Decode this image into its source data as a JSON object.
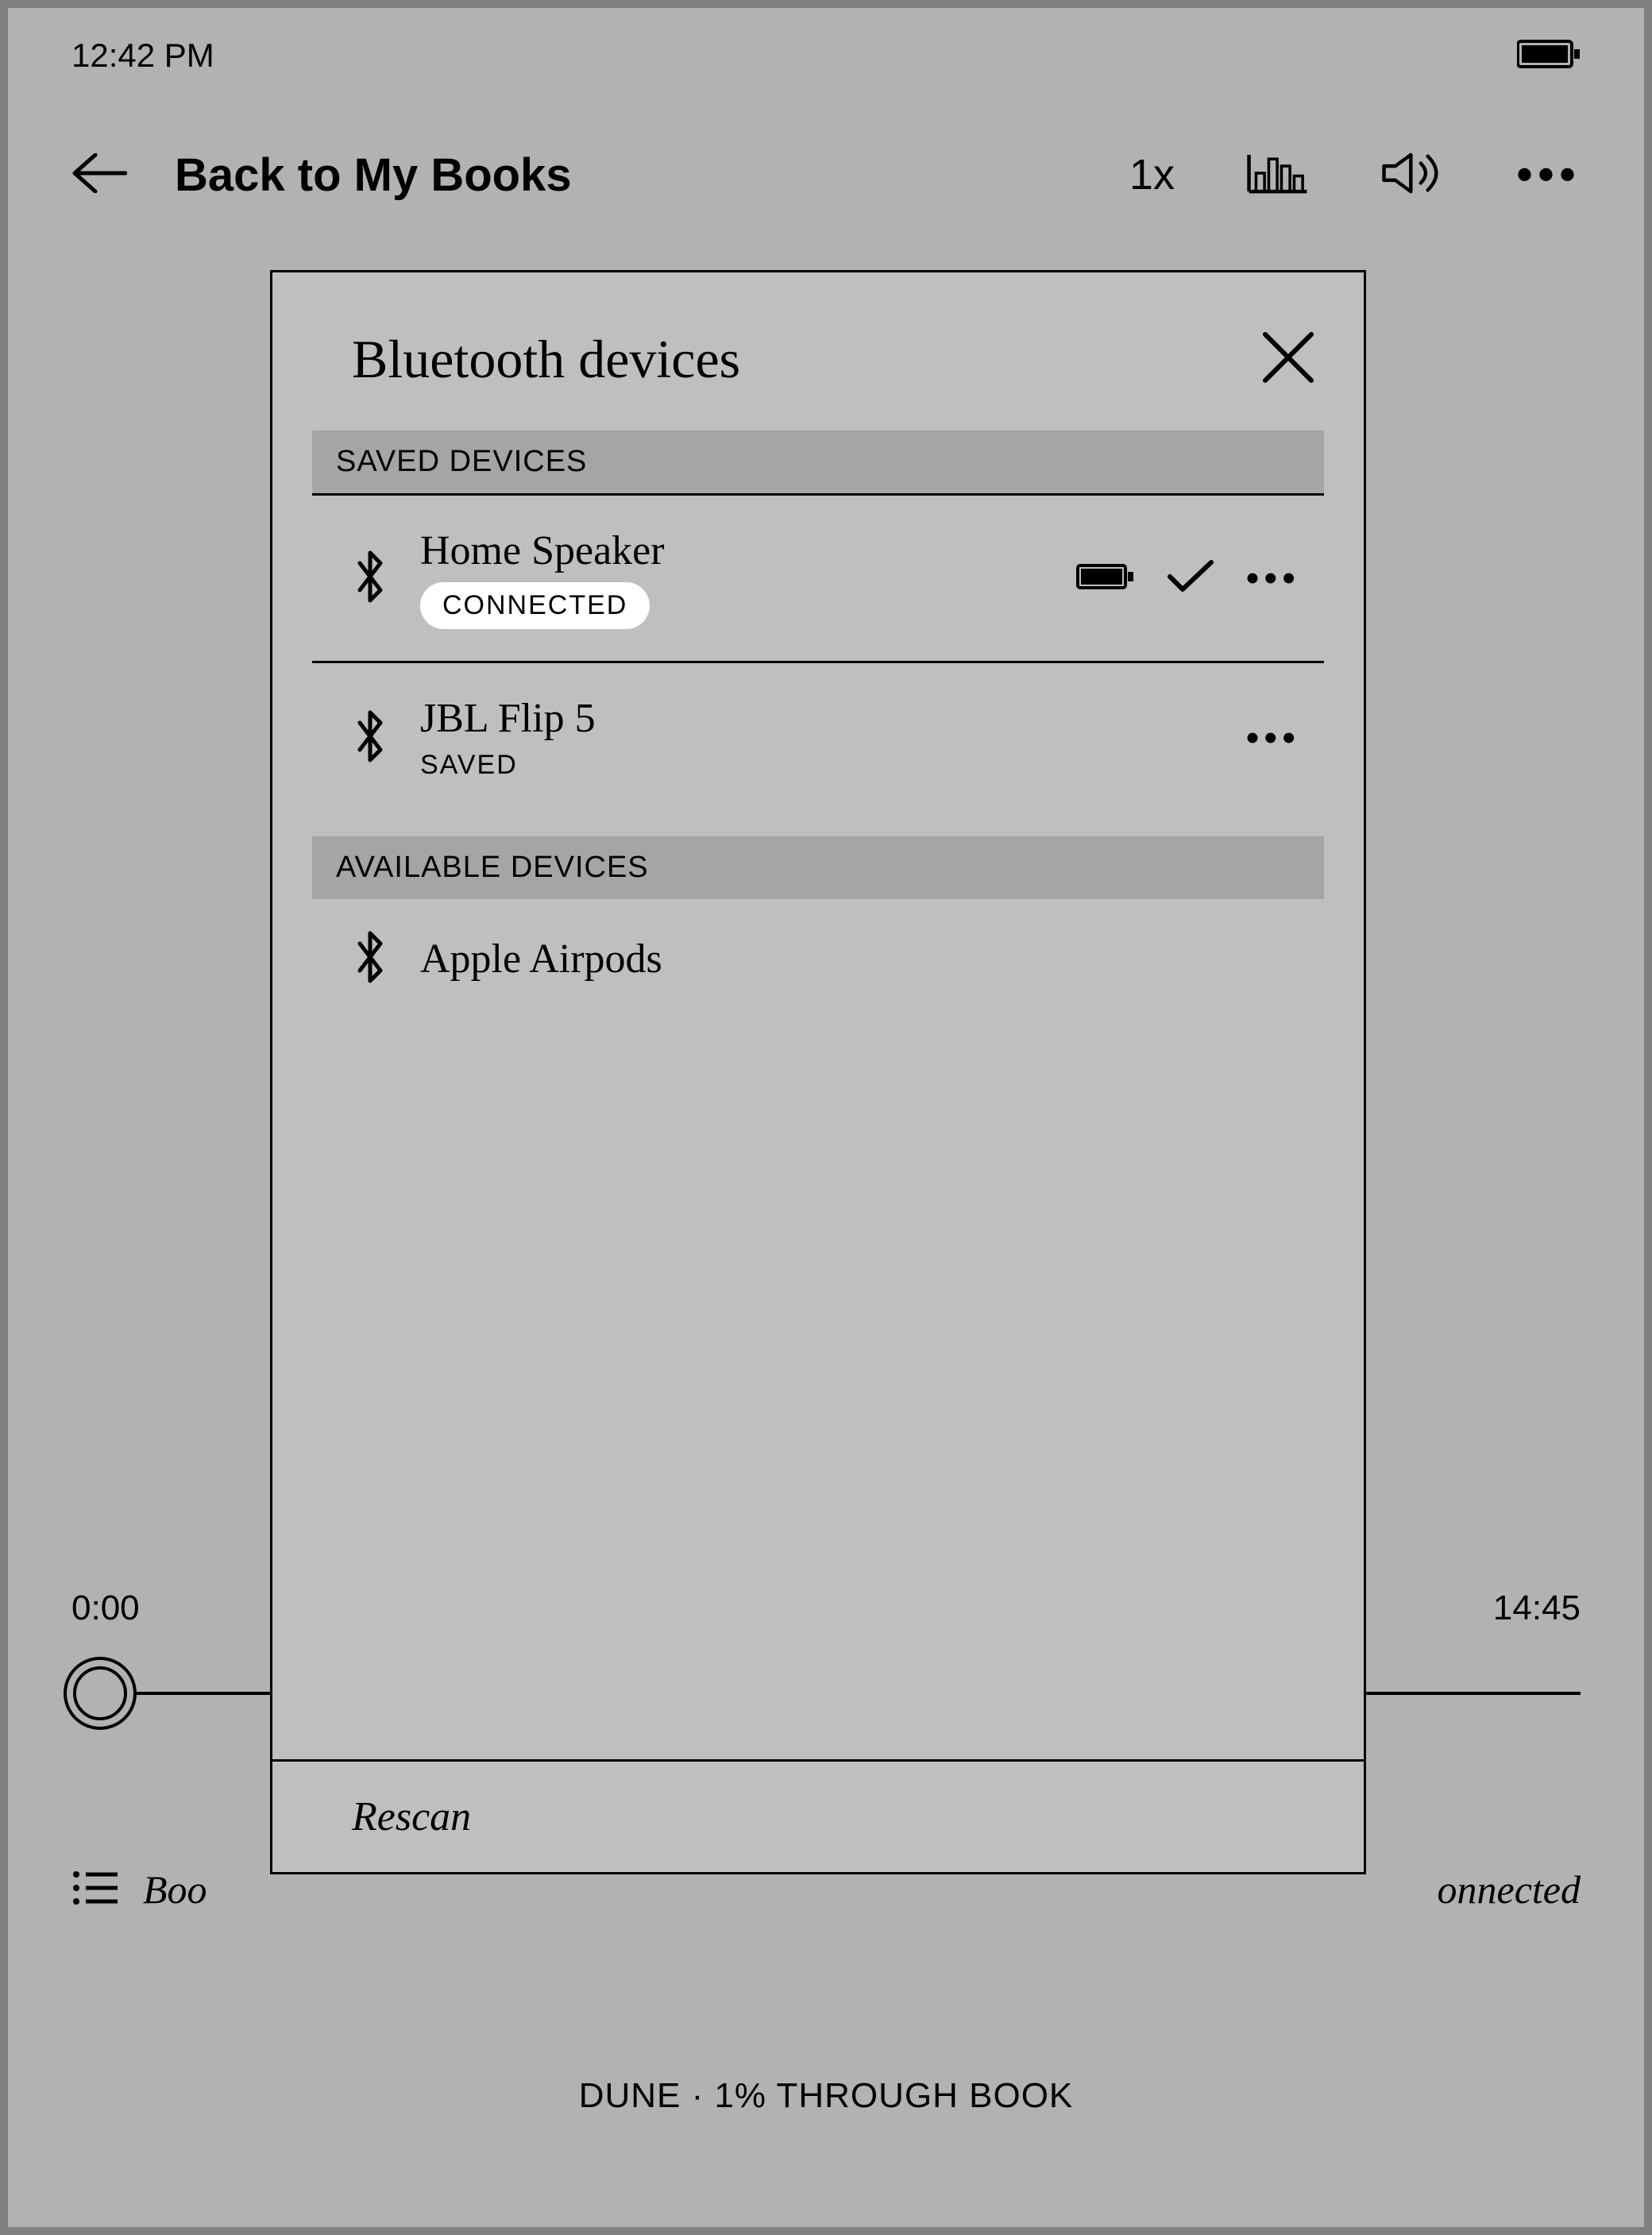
{
  "status": {
    "time": "12:42 PM"
  },
  "nav": {
    "back_label": "Back to My Books",
    "speed": "1x"
  },
  "player": {
    "elapsed": "0:00",
    "remaining": "14:45"
  },
  "bottom": {
    "chapter_partial_left": "Boo",
    "connected_partial_right": "onnected"
  },
  "footer": {
    "progress": "DUNE · 1% THROUGH BOOK"
  },
  "modal": {
    "title": "Bluetooth devices",
    "saved_header": "SAVED DEVICES",
    "available_header": "AVAILABLE DEVICES",
    "rescan_label": "Rescan",
    "saved_devices": [
      {
        "name": "Home Speaker",
        "status": "CONNECTED",
        "connected": true
      },
      {
        "name": "JBL Flip 5",
        "status": "SAVED",
        "connected": false
      }
    ],
    "available_devices": [
      {
        "name": "Apple Airpods"
      }
    ]
  }
}
